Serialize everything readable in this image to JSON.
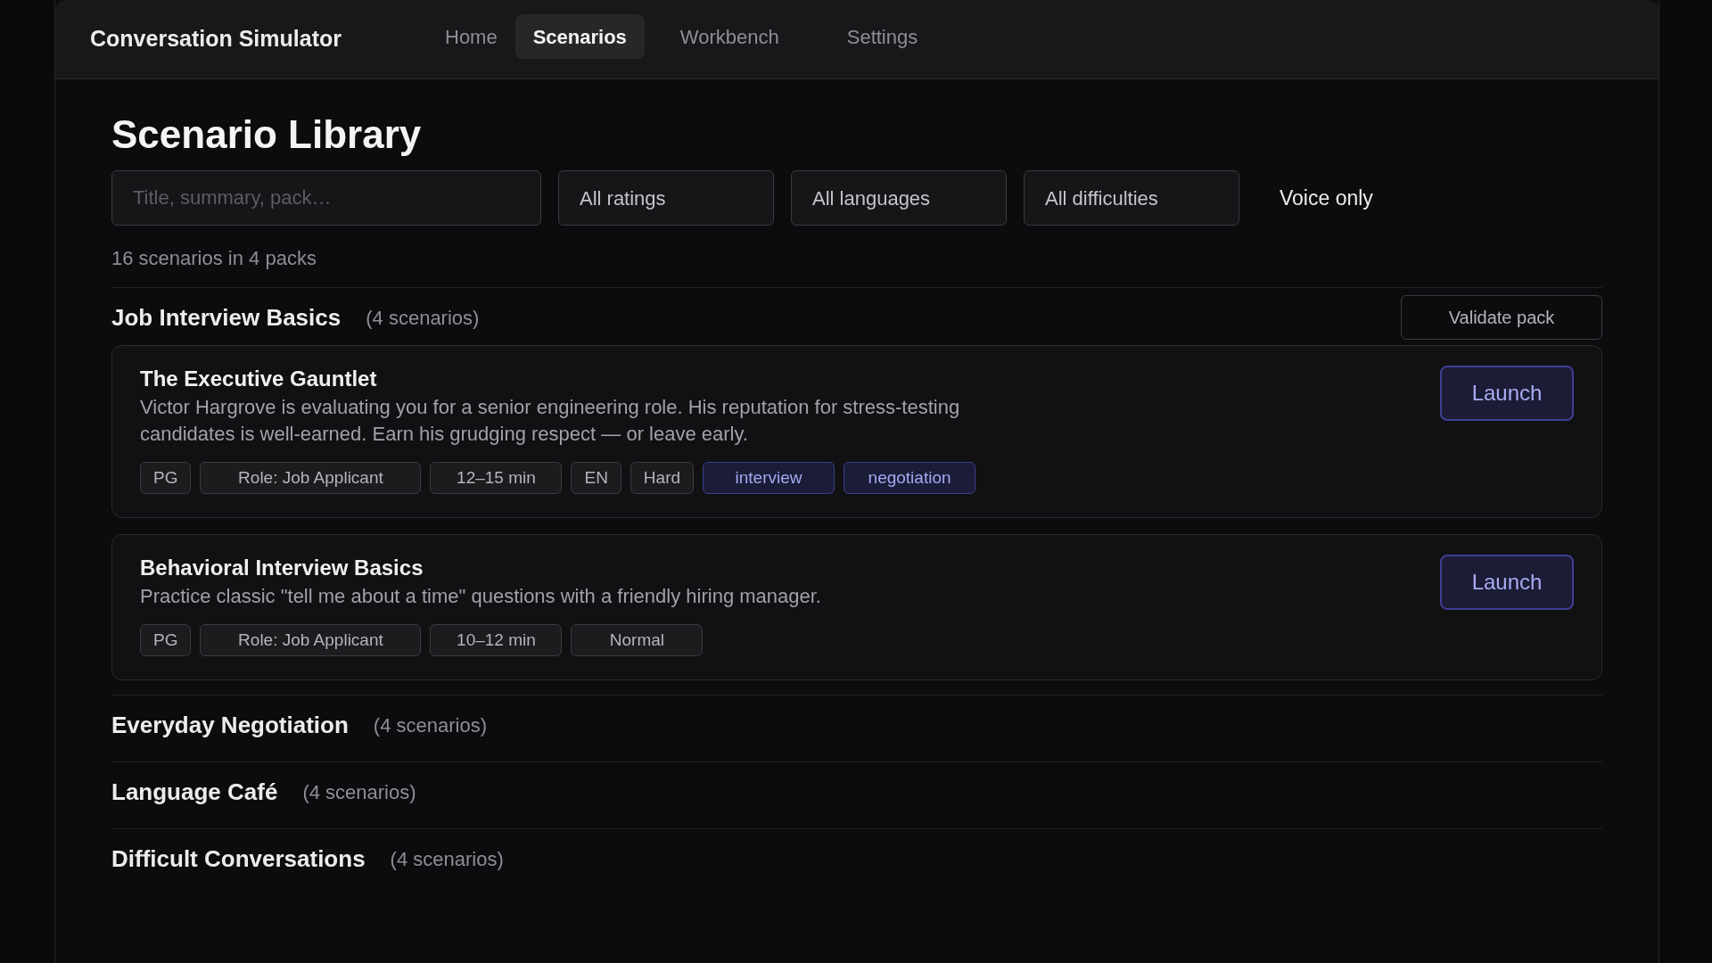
{
  "app": {
    "title": "Conversation Simulator"
  },
  "nav": [
    {
      "label": "Home",
      "selected": false
    },
    {
      "label": "Scenarios",
      "selected": true
    },
    {
      "label": "Workbench",
      "selected": false
    },
    {
      "label": "Settings",
      "selected": false
    }
  ],
  "page_title": "Scenario Library",
  "filters": {
    "search": {
      "placeholder": "Title, summary, pack…"
    },
    "selects": [
      "All ratings",
      "All languages",
      "All difficulties"
    ],
    "voice_only": "Voice only"
  },
  "summary": "16 scenarios in 4 packs",
  "packs": [
    {
      "name": "Job Interview Basics",
      "count": "(4 scenarios)",
      "validate_label": "Validate pack",
      "scenarios": [
        {
          "title": "The Executive Gauntlet",
          "description": "Victor Hargrove is evaluating you for a senior engineering role. His reputation for stress-testing candidates is well-earned. Earn his grudging respect — or leave early.",
          "launch": "Launch",
          "chips": [
            {
              "label": "PG",
              "kind": "meta"
            },
            {
              "label": "Role: Job Applicant",
              "kind": "meta"
            },
            {
              "label": "12–15 min",
              "kind": "meta"
            },
            {
              "label": "EN",
              "kind": "meta"
            },
            {
              "label": "Hard",
              "kind": "meta"
            },
            {
              "label": "interview",
              "kind": "tag"
            },
            {
              "label": "negotiation",
              "kind": "tag"
            }
          ]
        },
        {
          "title": "Behavioral Interview Basics",
          "description": "Practice classic \"tell me about a time\" questions with a friendly hiring manager.",
          "launch": "Launch",
          "chips": [
            {
              "label": "PG",
              "kind": "meta"
            },
            {
              "label": "Role: Job Applicant",
              "kind": "meta"
            },
            {
              "label": "10–12 min",
              "kind": "meta"
            },
            {
              "label": "Normal",
              "kind": "meta"
            }
          ]
        }
      ]
    },
    {
      "name": "Everyday Negotiation",
      "count": "(4 scenarios)"
    },
    {
      "name": "Language Café",
      "count": "(4 scenarios)"
    },
    {
      "name": "Difficult Conversations",
      "count": "(4 scenarios)"
    }
  ]
}
